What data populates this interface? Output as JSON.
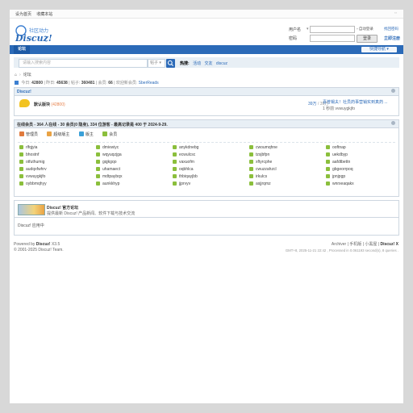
{
  "topbar": {
    "set_home": "设为首页",
    "bookmark": "收藏本站",
    "switch_width": "⇔"
  },
  "logo": {
    "tagline": "社区动力",
    "wordmark": "Discuz!"
  },
  "login": {
    "username_label": "用户名",
    "password_label": "密码",
    "auto_login": "自动登录",
    "forgot_password": "找回密码",
    "login_button": "登录",
    "register": "立即注册"
  },
  "nav": {
    "current": "论坛",
    "quick_nav": "快捷导航"
  },
  "search": {
    "placeholder": "请输入搜索内容",
    "type": "帖子",
    "hot_label": "热搜:",
    "hot": [
      "活动",
      "交友",
      "discuz"
    ]
  },
  "breadcrumb": {
    "home_icon": "home-icon",
    "current": "论坛"
  },
  "stats": {
    "today_label": "今日:",
    "today": "42800",
    "yesterday_label": "昨日:",
    "yesterday": "45638",
    "posts_label": "帖子:",
    "posts": "360481",
    "members_label": "会员:",
    "members": "66",
    "newest_label": "欢迎新会员:",
    "newest": "SberReads"
  },
  "forum_section": {
    "title": "Discuz!",
    "forum_name": "默认版块",
    "forum_today": "(42800)",
    "topics": "39万",
    "posts": "39万",
    "last_post_title": "喜普锡夫！社员药事营销实到真药 ...",
    "last_post_meta": "1 秒前 vvwuygkjfo"
  },
  "online": {
    "header": "在线会员 - 364 人在线 - 30 会员(0 隐身), 334 位游客 - 最高记录是 400 于 2024-9-29.",
    "legend": [
      "管理员",
      "超级版主",
      "版主",
      "会员"
    ],
    "legend_colors": [
      "#e07a3d",
      "#e9a244",
      "#3aa0d8",
      "#8bbf3c"
    ],
    "users": [
      "rlfqjyia",
      "dmivwiyc",
      "anykdnebg",
      "cwoumqhne",
      "ooftnap",
      "bhostnf",
      "wqyuqzjga",
      "ecwulcsc",
      "tzsjbfpn",
      "uekdbyp",
      "otfuthumig",
      "gqjkgqo",
      "vaxuofm",
      "xftyrcphe",
      "aafdtbettn",
      "audqxfwhrv",
      "uhamaect",
      "oqbhlca",
      "cwuzzahzcl",
      "gbgeorrpoq",
      "vvwuygkjfo",
      "mdtpaybqx",
      "thbiqayjbb",
      "irkulcs",
      "jpnjpgp",
      "oybbmqhyy",
      "aunkkhyp",
      "jjprvyv",
      "asjjrqmz",
      "wnrxeaqakx"
    ]
  },
  "partner": {
    "name": "Discuz! 官方论坛",
    "desc": "提供最新 Discuz! 产品新闻、软件下载与技术交流",
    "app": "Discuz! 应用中"
  },
  "footer": {
    "powered_prefix": "Powered by",
    "product": "Discuz!",
    "version": "X3.5",
    "copyright": "© 2001-2025 Discuz! Team.",
    "links": [
      "Archiver",
      "手机版",
      "小黑屋",
      "Discuz! X"
    ],
    "stats": "GMT+8, 2025-11-21 22:42 , Processed in 0.061193 second(s), 8 queries ."
  }
}
